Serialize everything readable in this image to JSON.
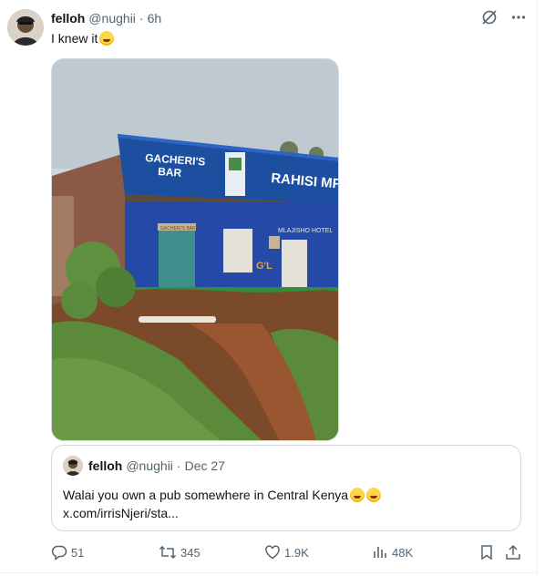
{
  "tweet": {
    "author_name": "felloh",
    "handle": "@nughii",
    "separator": "·",
    "time": "6h",
    "text": "I knew it"
  },
  "photo": {
    "sign_left_line1": "GACHERI'S",
    "sign_left_line2": "BAR",
    "sign_right": "RAHISI MFU",
    "door_sign_left": "GACHERI'S BAR",
    "door_sign_right": "MLAJISHO  HOTEL",
    "logo_text": "G'L"
  },
  "quote": {
    "author_name": "felloh",
    "handle": "@nughii",
    "separator": "·",
    "date": "Dec 27",
    "text": "Walai you own a pub somewhere in Central Kenya",
    "link": "x.com/irrisNjeri/sta..."
  },
  "actions": {
    "replies": "51",
    "reposts": "345",
    "likes": "1.9K",
    "views": "48K"
  },
  "icons": {
    "top": [
      "grok-icon",
      "more-icon"
    ],
    "actions": [
      "reply-icon",
      "repost-icon",
      "like-icon",
      "views-icon",
      "bookmark-icon",
      "share-icon"
    ]
  },
  "colors": {
    "text": "#0f1419",
    "muted": "#536471",
    "border": "#cfd9de",
    "bar_blue": "#1c4fa0"
  }
}
